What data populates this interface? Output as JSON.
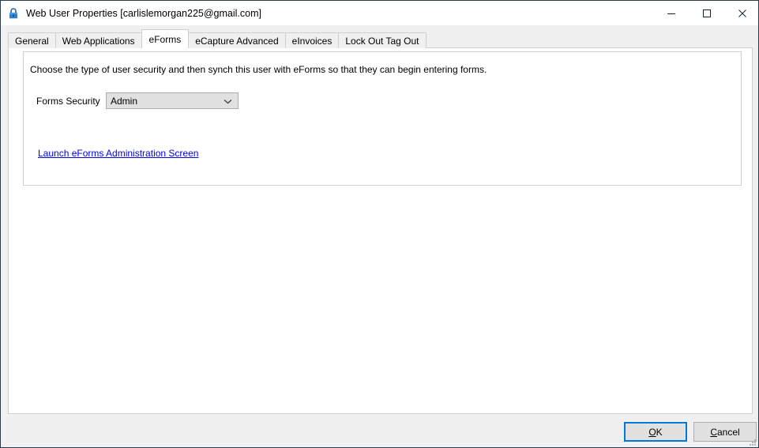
{
  "window": {
    "title": "Web User Properties [carlislemorgan225@gmail.com]",
    "icon": "lock-icon",
    "controls": {
      "minimize": "minimize-icon",
      "maximize": "maximize-icon",
      "close": "close-icon"
    },
    "colors": {
      "border": "#2b3a4a",
      "titlebar_bg": "#ffffff",
      "dialog_bg": "#f0f0f0",
      "page_bg": "#ffffff",
      "focus_accent": "#0078d7",
      "link": "#0000ee",
      "control_face": "#e1e1e1"
    }
  },
  "tabs": [
    {
      "label": "General",
      "active": false
    },
    {
      "label": "Web Applications",
      "active": false
    },
    {
      "label": "eForms",
      "active": true
    },
    {
      "label": "eCapture Advanced",
      "active": false
    },
    {
      "label": "eInvoices",
      "active": false
    },
    {
      "label": "Lock Out Tag Out",
      "active": false
    }
  ],
  "eforms_page": {
    "instructions": "Choose the type of user security and then synch this user with eForms so that they can begin entering forms.",
    "forms_security": {
      "label": "Forms Security",
      "value": "Admin",
      "options": [
        "Admin"
      ],
      "dropdown_icon": "chevron-down-icon"
    },
    "admin_link": "Launch eForms Administration Screen"
  },
  "footer": {
    "ok": {
      "accel": "O",
      "rest": "K"
    },
    "cancel": {
      "accel": "C",
      "rest": "ancel"
    }
  }
}
